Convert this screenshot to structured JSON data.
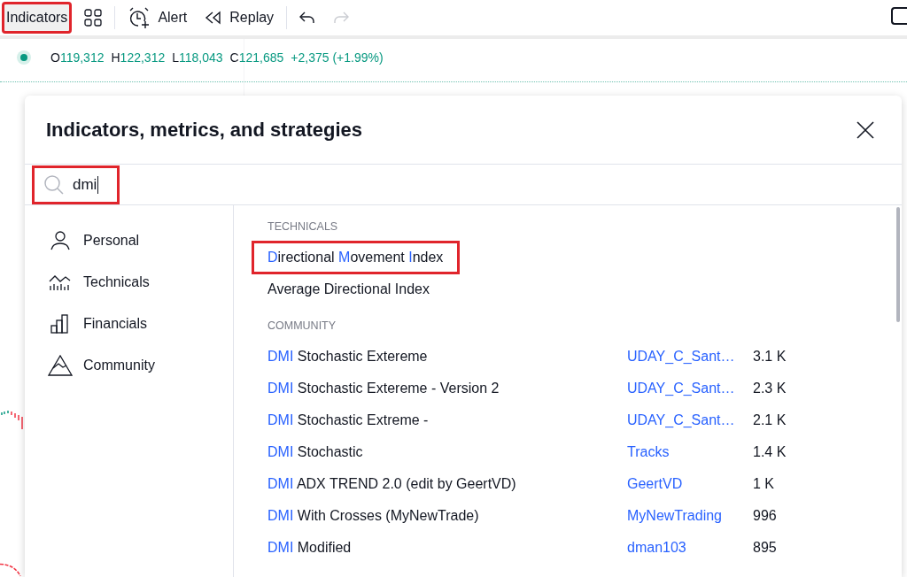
{
  "toolbar": {
    "buttons": [
      {
        "kind": "text",
        "label": "Indicators",
        "highlighted": true,
        "disabled": false
      },
      {
        "kind": "layouts",
        "disabled": false
      },
      {
        "kind": "alert",
        "label": "Alert",
        "disabled": false
      },
      {
        "kind": "replay",
        "label": "Replay",
        "disabled": false
      },
      {
        "kind": "undo",
        "disabled": false
      },
      {
        "kind": "redo",
        "disabled": true
      }
    ]
  },
  "legend": {
    "values": [
      {
        "key": "O",
        "value": "119,312"
      },
      {
        "key": "H",
        "value": "122,312"
      },
      {
        "key": "L",
        "value": "118,043"
      },
      {
        "key": "C",
        "value": "121,685"
      }
    ],
    "change": "+2,375 (+1.99%)"
  },
  "dialog": {
    "title": "Indicators, metrics, and strategies",
    "search": {
      "value": "dmi",
      "highlighted": true
    },
    "categories": [
      {
        "kind": "personal",
        "label": "Personal"
      },
      {
        "kind": "technicals",
        "label": "Technicals"
      },
      {
        "kind": "financials",
        "label": "Financials"
      },
      {
        "kind": "community",
        "label": "Community"
      }
    ],
    "sections": [
      {
        "heading": "TECHNICALS",
        "results": [
          {
            "name": [
              {
                "text": "D",
                "match": true
              },
              {
                "text": "irectional ",
                "match": false
              },
              {
                "text": "M",
                "match": true
              },
              {
                "text": "ovement ",
                "match": false
              },
              {
                "text": "I",
                "match": true
              },
              {
                "text": "ndex",
                "match": false
              }
            ],
            "highlighted": true
          },
          {
            "name": [
              {
                "text": "Average Directional Index",
                "match": false
              }
            ],
            "highlighted": false
          }
        ]
      },
      {
        "heading": "COMMUNITY",
        "results": [
          {
            "name": [
              {
                "text": "DMI",
                "match": true
              },
              {
                "text": " Stochastic Extereme",
                "match": false
              }
            ],
            "author": "UDAY_C_Sant…",
            "uses": "3.1 K",
            "highlighted": false
          },
          {
            "name": [
              {
                "text": "DMI",
                "match": true
              },
              {
                "text": " Stochastic Extereme - Version 2",
                "match": false
              }
            ],
            "author": "UDAY_C_Sant…",
            "uses": "2.3 K",
            "highlighted": false
          },
          {
            "name": [
              {
                "text": "DMI",
                "match": true
              },
              {
                "text": " Stochastic Extreme -",
                "match": false
              }
            ],
            "author": "UDAY_C_Sant…",
            "uses": "2.1 K",
            "highlighted": false
          },
          {
            "name": [
              {
                "text": "DMI",
                "match": true
              },
              {
                "text": " Stochastic",
                "match": false
              }
            ],
            "author": "Tracks",
            "uses": "1.4 K",
            "highlighted": false
          },
          {
            "name": [
              {
                "text": "DMI",
                "match": true
              },
              {
                "text": " ADX TREND 2.0 (edit by GeertVD)",
                "match": false
              }
            ],
            "author": "GeertVD",
            "uses": "1 K",
            "highlighted": false
          },
          {
            "name": [
              {
                "text": "DMI",
                "match": true
              },
              {
                "text": " With Crosses (MyNewTrade)",
                "match": false
              }
            ],
            "author": "MyNewTrading",
            "uses": "996",
            "highlighted": false
          },
          {
            "name": [
              {
                "text": "DMI",
                "match": true
              },
              {
                "text": " Modified",
                "match": false
              }
            ],
            "author": "dman103",
            "uses": "895",
            "highlighted": false
          }
        ]
      }
    ]
  }
}
